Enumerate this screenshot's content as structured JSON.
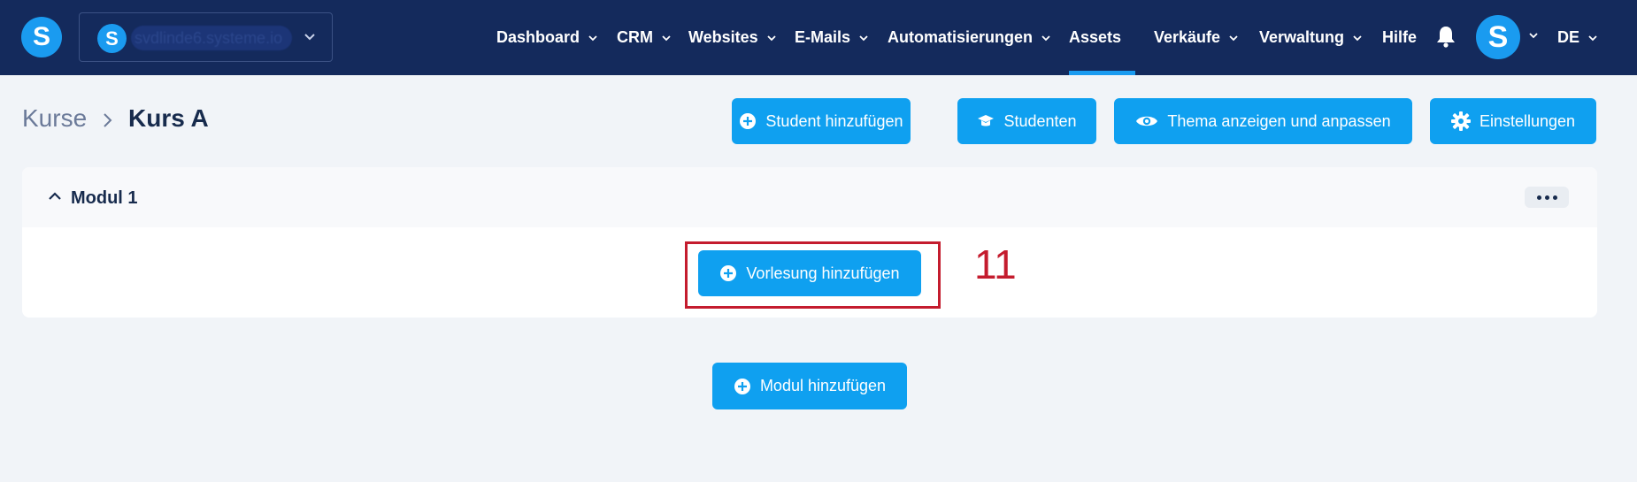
{
  "app": {
    "logo_letter": "S",
    "domain": "svdlinde6.systeme.io",
    "accent_color": "#0fa0f0",
    "nav_background": "#142a5c"
  },
  "nav": {
    "items": [
      {
        "label": "Dashboard",
        "has_caret": true
      },
      {
        "label": "CRM",
        "has_caret": true
      },
      {
        "label": "Websites",
        "has_caret": true
      },
      {
        "label": "E-Mails",
        "has_caret": true
      },
      {
        "label": "Automatisierungen",
        "has_caret": true
      },
      {
        "label": "Assets",
        "has_caret": false,
        "active": true
      },
      {
        "label": "Verkäufe",
        "has_caret": true
      },
      {
        "label": "Verwaltung",
        "has_caret": true
      },
      {
        "label": "Hilfe",
        "has_caret": false
      }
    ],
    "avatar_letter": "S",
    "language": "DE"
  },
  "breadcrumb": {
    "root": "Kurse",
    "current": "Kurs A"
  },
  "actions": {
    "add_student": "Student hinzufügen",
    "students": "Studenten",
    "theme": "Thema anzeigen und anpassen",
    "settings": "Einstellungen"
  },
  "module": {
    "title": "Modul 1",
    "add_lecture": "Vorlesung hinzufügen"
  },
  "add_module": "Modul hinzufügen",
  "annotation": {
    "number": "11",
    "color": "#c41c2e"
  }
}
